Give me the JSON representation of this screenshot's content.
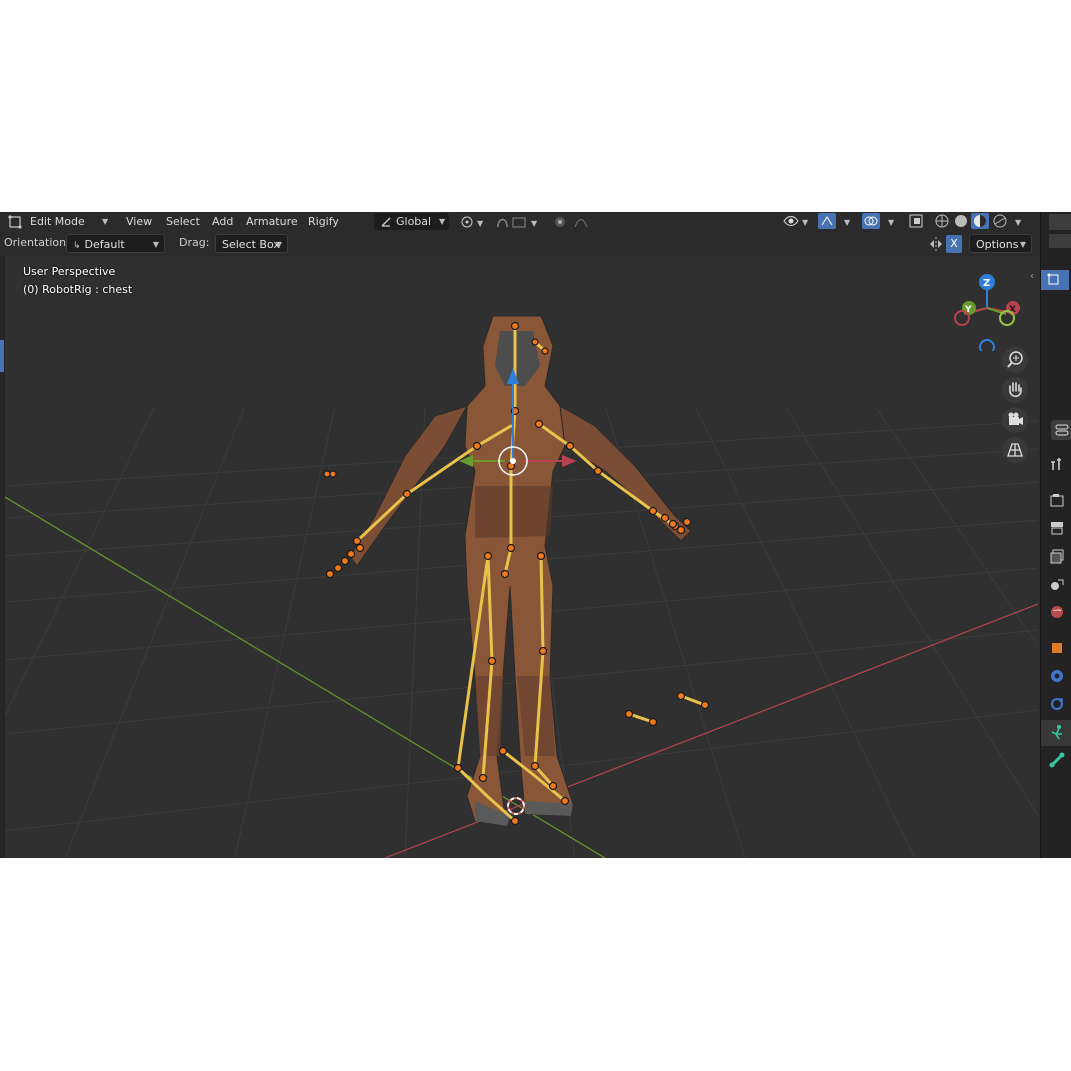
{
  "header": {
    "mode": "Edit Mode",
    "menus": [
      "View",
      "Select",
      "Add",
      "Armature",
      "Rigify"
    ],
    "transform_orientation": "Global"
  },
  "toolbar": {
    "orientation_label": "Orientation:",
    "orientation_value": "Default",
    "drag_label": "Drag:",
    "drag_value": "Select Box",
    "x_mirror": "X",
    "options_label": "Options"
  },
  "viewport": {
    "view_name": "User Perspective",
    "active_object": "(0) RobotRig : chest",
    "gizmo_axes": [
      "Z",
      "Y",
      "X"
    ]
  },
  "colors": {
    "bone": "#e8c24a",
    "joint": "#f07a1a",
    "x_axis": "#b8434f",
    "y_axis": "#6a9a2e",
    "z_axis": "#2f7fd8",
    "accent": "#4772b3"
  },
  "properties_tabs": [
    "tool-icon",
    "render-icon",
    "output-icon",
    "view-layer-icon",
    "scene-icon",
    "world-icon",
    "object-icon",
    "modifiers-icon",
    "physics-icon",
    "object-data-armature-icon",
    "bone-icon"
  ]
}
